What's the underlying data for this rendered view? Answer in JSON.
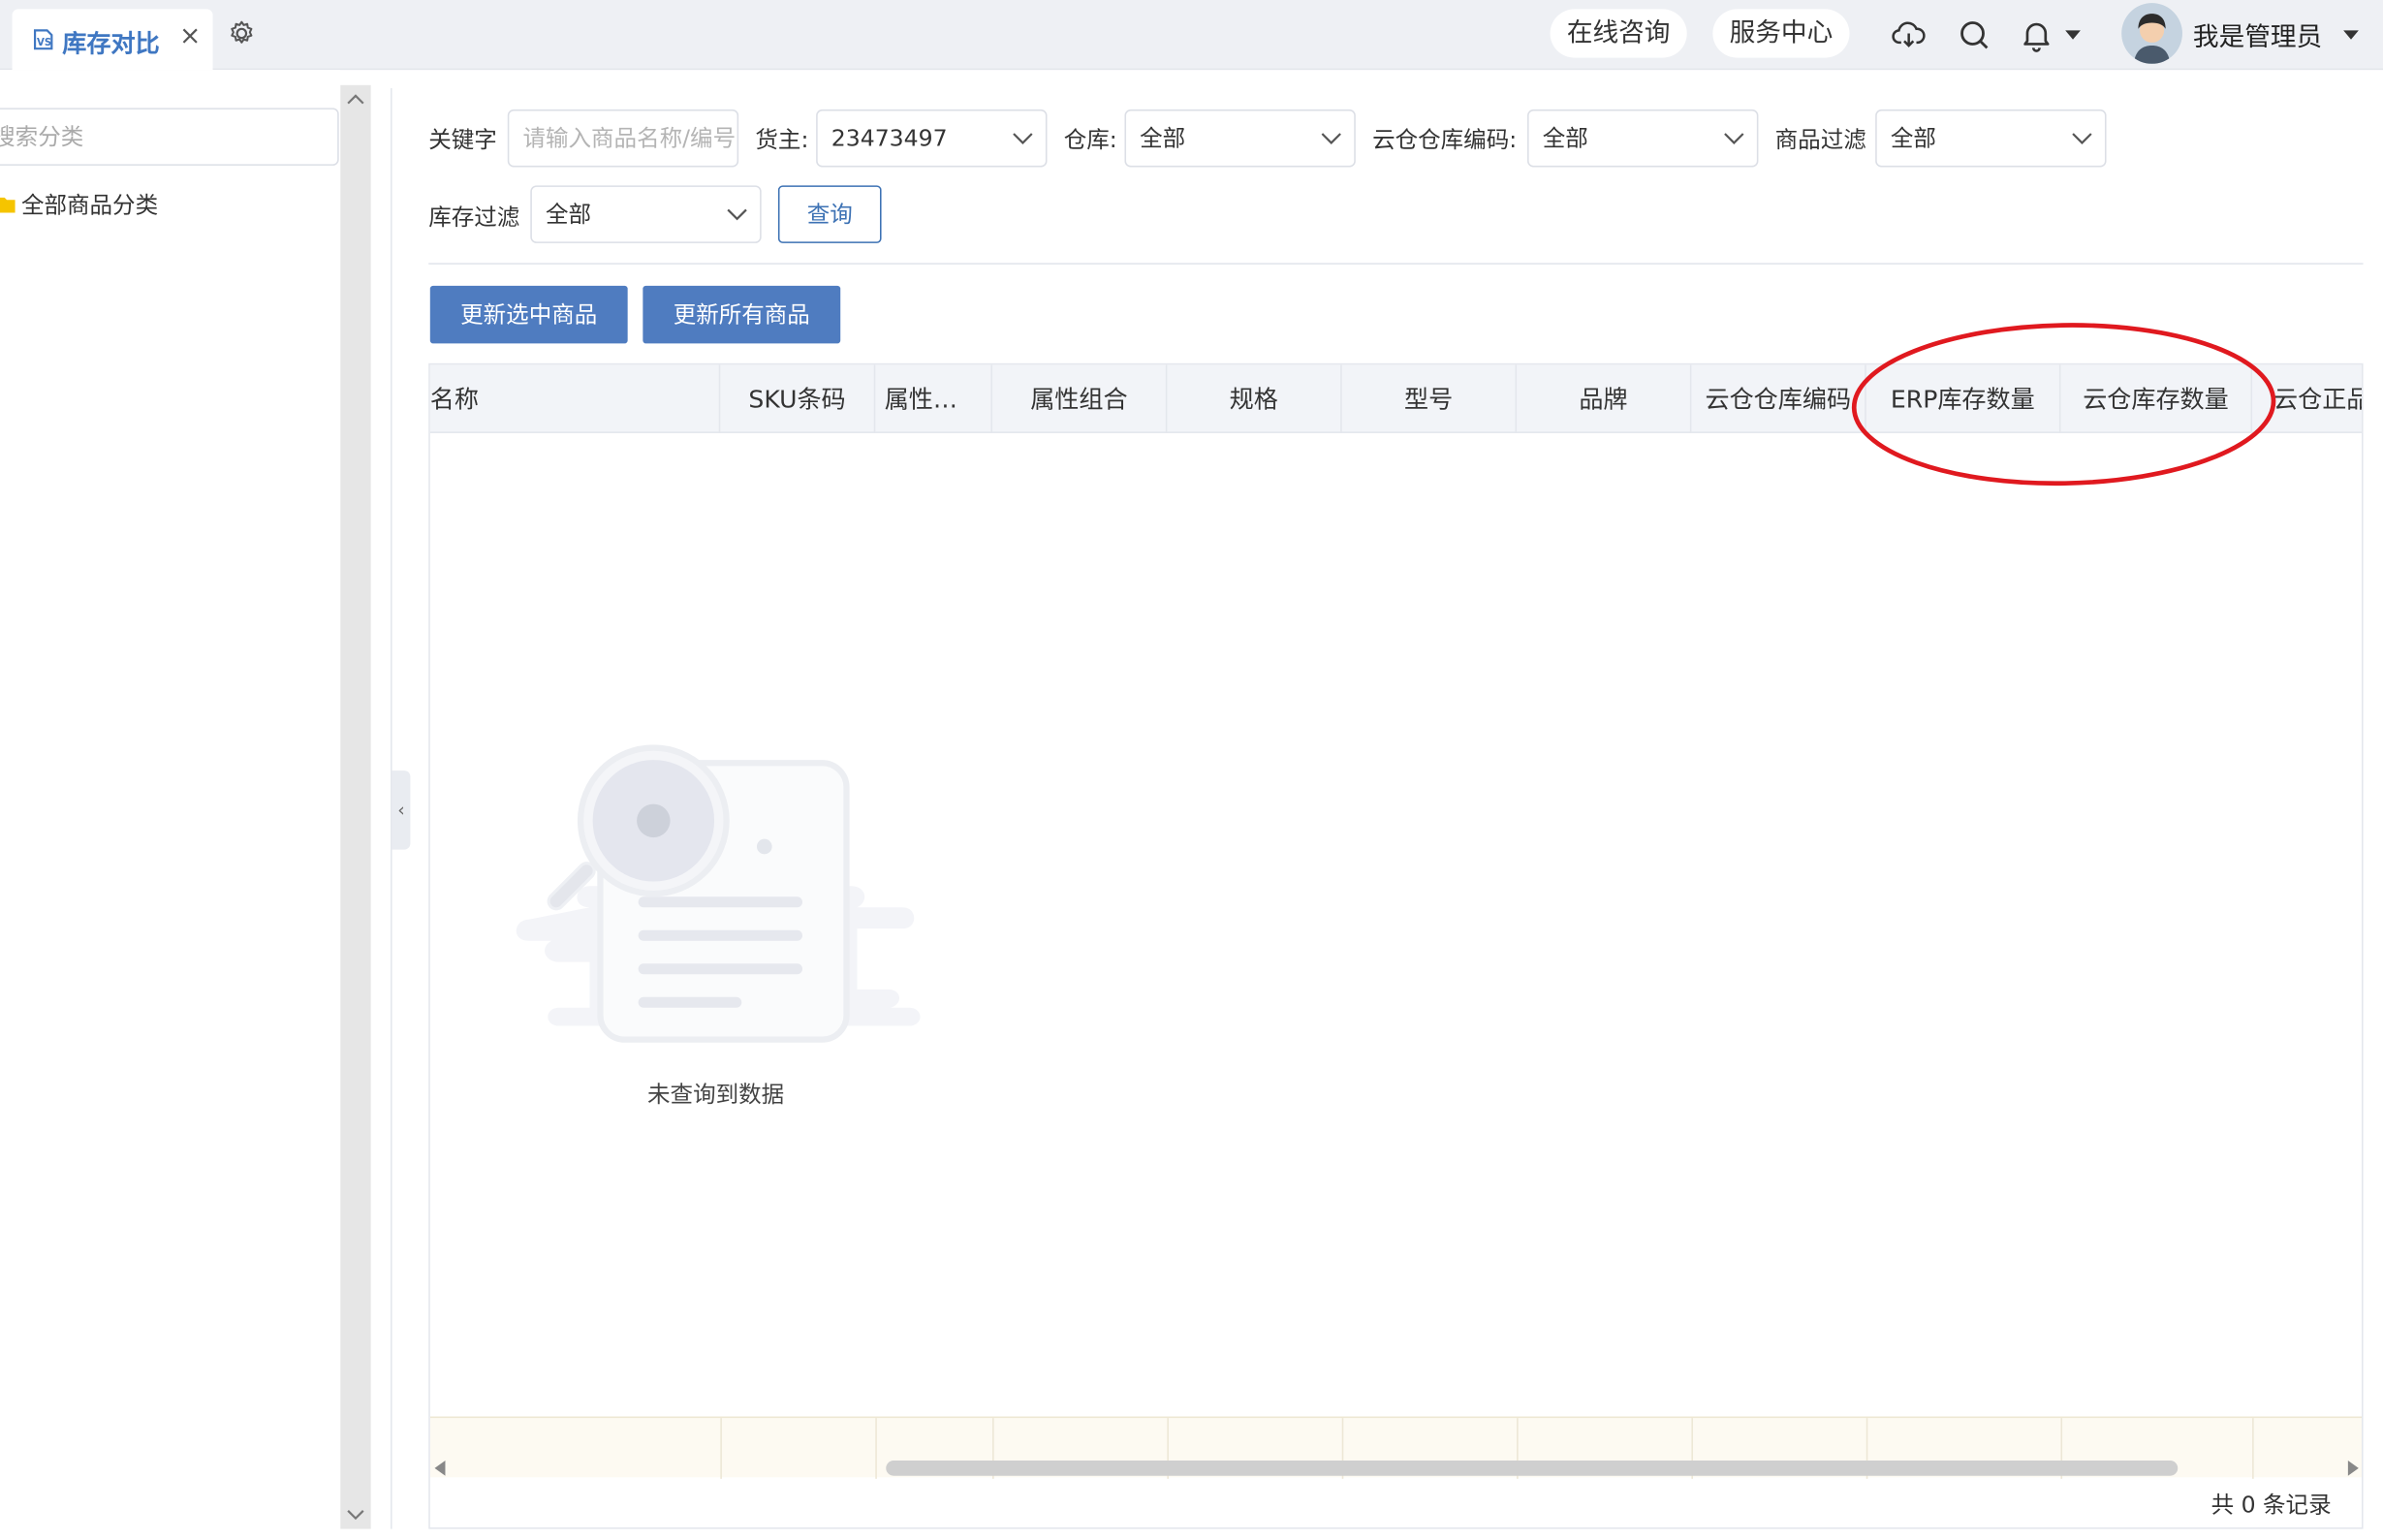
{
  "tab": {
    "icon": "vs-logo-icon",
    "title": "库存对比",
    "close": "×"
  },
  "header": {
    "online_consult": "在线咨询",
    "service_center": "服务中心",
    "user_name": "我是管理员"
  },
  "left_panel": {
    "search_placeholder": "搜索分类",
    "categories": [
      "全部商品分类"
    ]
  },
  "filters": {
    "keyword_label": "关键字",
    "keyword_placeholder": "请输入商品名称/编号",
    "owner_label": "货主:",
    "owner_value": "23473497",
    "warehouse_label": "仓库:",
    "warehouse_value": "全部",
    "cloud_code_label": "云仓仓库编码:",
    "cloud_code_value": "全部",
    "product_filter_label": "商品过滤",
    "product_filter_value": "全部",
    "stock_filter_label": "库存过滤",
    "stock_filter_value": "全部",
    "query_button": "查询"
  },
  "actions": {
    "update_selected": "更新选中商品",
    "update_all": "更新所有商品"
  },
  "table": {
    "columns": [
      "名称",
      "SKU条码",
      "属性…",
      "属性组合",
      "规格",
      "型号",
      "品牌",
      "云仓仓库编码",
      "ERP库存数量",
      "云仓库存数量",
      "云仓正品"
    ],
    "empty_text": "未查询到数据",
    "total_text": "共 0 条记录"
  },
  "colors": {
    "accent": "#4f7cc0",
    "highlight_circle": "#e0191f",
    "tab_title": "#3f77c2"
  }
}
